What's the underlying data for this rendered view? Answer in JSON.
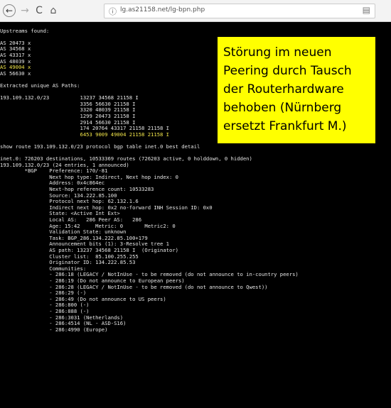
{
  "browser": {
    "url": "lg.as21158.net/lg-bpn.php",
    "back_icon": "←",
    "forward_icon": "→",
    "reload_icon": "C",
    "home_icon": "⌂",
    "info_icon": "ⓘ",
    "reader_icon": "▤"
  },
  "terminal": {
    "lines": [
      "",
      "Upstreams found:",
      "",
      "AS 20473 x",
      "AS 34568 x",
      "AS 43317 x",
      "AS 48039 x",
      "AS 49004 x",
      "AS 56630 x",
      "",
      "Extracted unique AS Paths:",
      "",
      "193.109.132.0/23          13237 34568 21158 I",
      "                          3356 56630 21158 I",
      "                          3320 48039 21158 I",
      "                          1299 20473 21158 I",
      "                          2914 56630 21158 I",
      "                          174 20764 43317 21158 21158 I",
      "                          6453 9009 49004 21158 21158 I",
      "",
      "show route 193.109.132.0/23 protocol bgp table inet.0 best detail",
      "",
      "inet.0: 726203 destinations, 10533369 routes (726203 active, 0 holddown, 0 hidden)",
      "193.109.132.0/23 (24 entries, 1 announced)",
      "        *BGP    Preference: 170/-81",
      "                Next hop type: Indirect, Next hop index: 0",
      "                Address: 0x4c864ec",
      "                Next-hop reference count: 10533283",
      "                Source: 134.222.85.100",
      "                Protocol next hop: 62.132.1.6",
      "                Indirect next hop: 0x2 no-forward INH Session ID: 0x0",
      "                State: <Active Int Ext>",
      "                Local AS:   286 Peer AS:   286",
      "                Age: 15:42     Metric: 0       Metric2: 0",
      "                Validation State: unknown",
      "                Task: BGP_286.134.222.85.100+179",
      "                Announcement bits (1): 3-Resolve tree 1",
      "                AS path: 13237 34568 21158 I  (Originator)",
      "                Cluster list:  85.100.255.255",
      "                Originator ID: 134.222.85.53",
      "                Communities:",
      "                - 286:18 (LEGACY / NotInUse - to be removed (do not announce to in-country peers)",
      "                - 286:19 (Do not announce to European peers)",
      "                - 286:28 (LEGACY / NotInUse - to be removed (do not announce to Qwest))",
      "                - 286:29 (-)",
      "                - 286:49 (Do not announce to US peers)",
      "                - 286:800 (-)",
      "                - 286:888 (-)",
      "                - 286:3031 (Netherlands)",
      "                - 286:4514 (NL - ASD-S16)",
      "                - 286:4990 (Europe)"
    ],
    "highlighted_lines": [
      "AS 49004 x",
      "                          6453 9009 49004 21158 21158 I"
    ],
    "text_color": "#e6e6e6",
    "highlight_color": "#f2e64a",
    "background": "#000000"
  },
  "note": {
    "lines": [
      "Störung im neuen",
      "Peering durch Tausch",
      "der Routerhardware",
      "behoben (Nürnberg",
      "ersetzt Frankfurt M.)"
    ],
    "background": "#ffff00"
  }
}
